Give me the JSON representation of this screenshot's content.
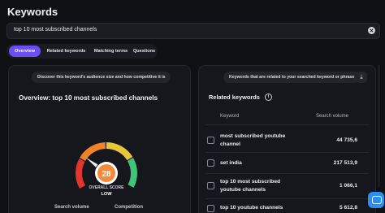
{
  "page": {
    "title": "Keywords"
  },
  "search": {
    "value": "top 10 most subscribed channels"
  },
  "tabs": [
    {
      "label": "Overview",
      "active": true
    },
    {
      "label": "Related keywords",
      "active": false
    },
    {
      "label": "Matching terms",
      "active": false
    },
    {
      "label": "Questions",
      "active": false
    }
  ],
  "overview": {
    "hint": "Discover this keyword's audience size and how competitive it is",
    "heading": "Overview: top 10 most subscribed channels",
    "score": "28",
    "score_fraction": 0.28,
    "score_label": "OVERALL SCORE",
    "score_level": "LOW",
    "caption_left": "Search volume",
    "caption_right": "Competition"
  },
  "related": {
    "hint": "Keywords that are related to your searched keyword or phrase",
    "heading": "Related keywords",
    "col_keyword": "Keyword",
    "col_volume": "Search volume",
    "rows": [
      {
        "keyword_line1": "most subscribed youtube",
        "keyword_line2": "channel",
        "volume": "44 735,6"
      },
      {
        "keyword_line1": "set india",
        "keyword_line2": "",
        "volume": "217 513,9"
      },
      {
        "keyword_line1": "top 10 most subscribed",
        "keyword_line2": "youtube channels",
        "volume": "1 066,1"
      },
      {
        "keyword_line1": "top 10 youtube channels",
        "keyword_line2": "",
        "volume": "5 612,8"
      }
    ]
  },
  "colors": {
    "accent": "#6b4ef6",
    "score_orange": "#f5893a",
    "gauge_red": "#e3342f",
    "gauge_orange": "#f0822a",
    "gauge_yellow": "#e8c63a",
    "gauge_green": "#3fc47a"
  },
  "icons": {
    "clear": "clear-icon",
    "info": "info-icon",
    "download": "download-icon",
    "chat": "chat-icon"
  }
}
